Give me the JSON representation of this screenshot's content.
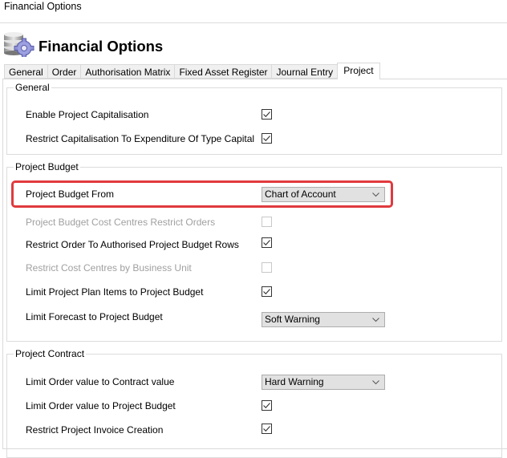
{
  "window": {
    "title": "Financial Options"
  },
  "header": {
    "title": "Financial Options",
    "icon": "database-gear-icon"
  },
  "tabs": [
    {
      "label": "General",
      "active": false
    },
    {
      "label": "Order",
      "active": false
    },
    {
      "label": "Authorisation Matrix",
      "active": false
    },
    {
      "label": "Fixed Asset Register",
      "active": false
    },
    {
      "label": "Journal Entry",
      "active": false
    },
    {
      "label": "Project",
      "active": true
    }
  ],
  "groups": {
    "general": {
      "title": "General",
      "rows": [
        {
          "label": "Enable Project Capitalisation",
          "checked": true,
          "enabled": true
        },
        {
          "label": "Restrict Capitalisation To Expenditure Of Type Capital",
          "checked": true,
          "enabled": true
        }
      ]
    },
    "project_budget": {
      "title": "Project Budget",
      "budget_from": {
        "label": "Project Budget From",
        "value": "Chart of Account",
        "highlighted": true,
        "highlight_color": "#e03a3e"
      },
      "rows": [
        {
          "label": "Project Budget Cost Centres Restrict Orders",
          "checked": false,
          "enabled": false
        },
        {
          "label": "Restrict Order To Authorised Project Budget Rows",
          "checked": true,
          "enabled": true
        },
        {
          "label": "Restrict Cost Centres by Business Unit",
          "checked": false,
          "enabled": false
        },
        {
          "label": "Limit Project Plan Items to Project Budget",
          "checked": true,
          "enabled": true
        }
      ],
      "forecast": {
        "label": "Limit Forecast to Project Budget",
        "value": "Soft Warning"
      }
    },
    "project_contract": {
      "title": "Project Contract",
      "order_contract": {
        "label": "Limit Order value to Contract value",
        "value": "Hard Warning"
      },
      "rows": [
        {
          "label": "Limit Order value to Project Budget",
          "checked": true,
          "enabled": true
        },
        {
          "label": "Restrict Project Invoice Creation",
          "checked": true,
          "enabled": true
        }
      ]
    }
  }
}
